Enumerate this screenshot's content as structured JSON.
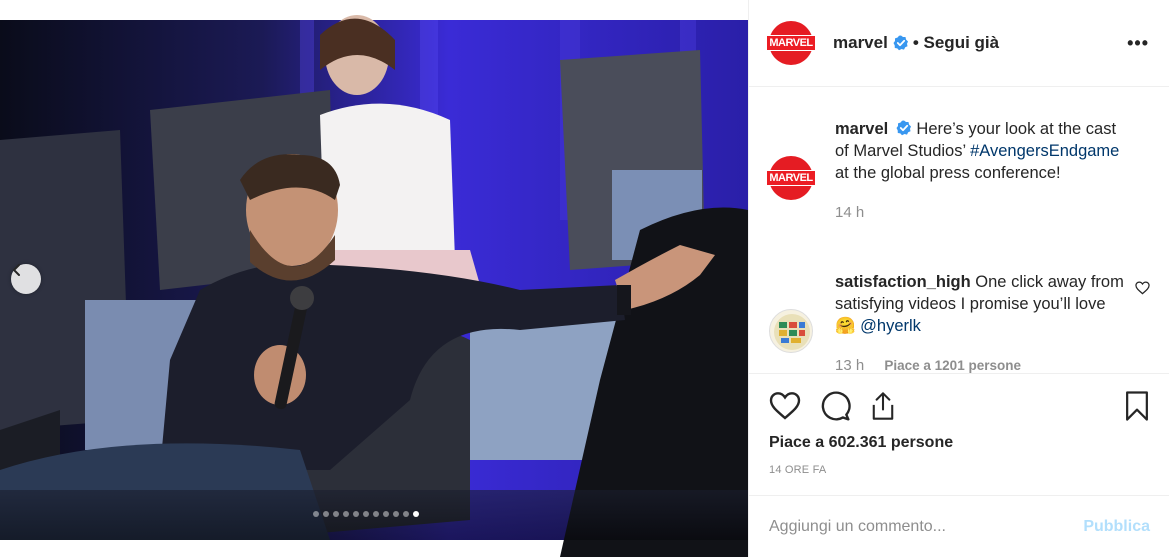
{
  "post": {
    "username": "marvel",
    "follow_status": "Segui già",
    "more_label": "•••",
    "avatar_text": "MARVEL",
    "verified_icon": "verified-badge-icon"
  },
  "caption": {
    "username": "marvel",
    "text_before": "Here’s your look at the cast of Marvel Studios’",
    "hashtag": "#AvengersEndgame",
    "text_after": "at the global press conference!",
    "time": "14 h"
  },
  "comment": {
    "username": "satisfaction_high",
    "text": "One click away from satisfying videos I promise you’ll love",
    "emoji": "🤗",
    "mention": "@hyerlk",
    "time": "13 h",
    "likes": "Piace a 1201 persone"
  },
  "carousel": {
    "total": 11,
    "active_index": 10,
    "prev_icon": "chevron-left-icon"
  },
  "actions": {
    "icons": [
      "heart-icon",
      "comment-icon",
      "share-icon",
      "bookmark-icon"
    ],
    "likes": "Piace a 602.361 persone",
    "time_ago": "14 ORE FA"
  },
  "add_comment": {
    "placeholder": "Aggiungi un commento...",
    "publish_label": "Pubblica"
  },
  "colors": {
    "link": "#00376b",
    "verified": "#3897f0",
    "publish_disabled": "#b2dffc",
    "marvel_red": "#e51c23"
  }
}
